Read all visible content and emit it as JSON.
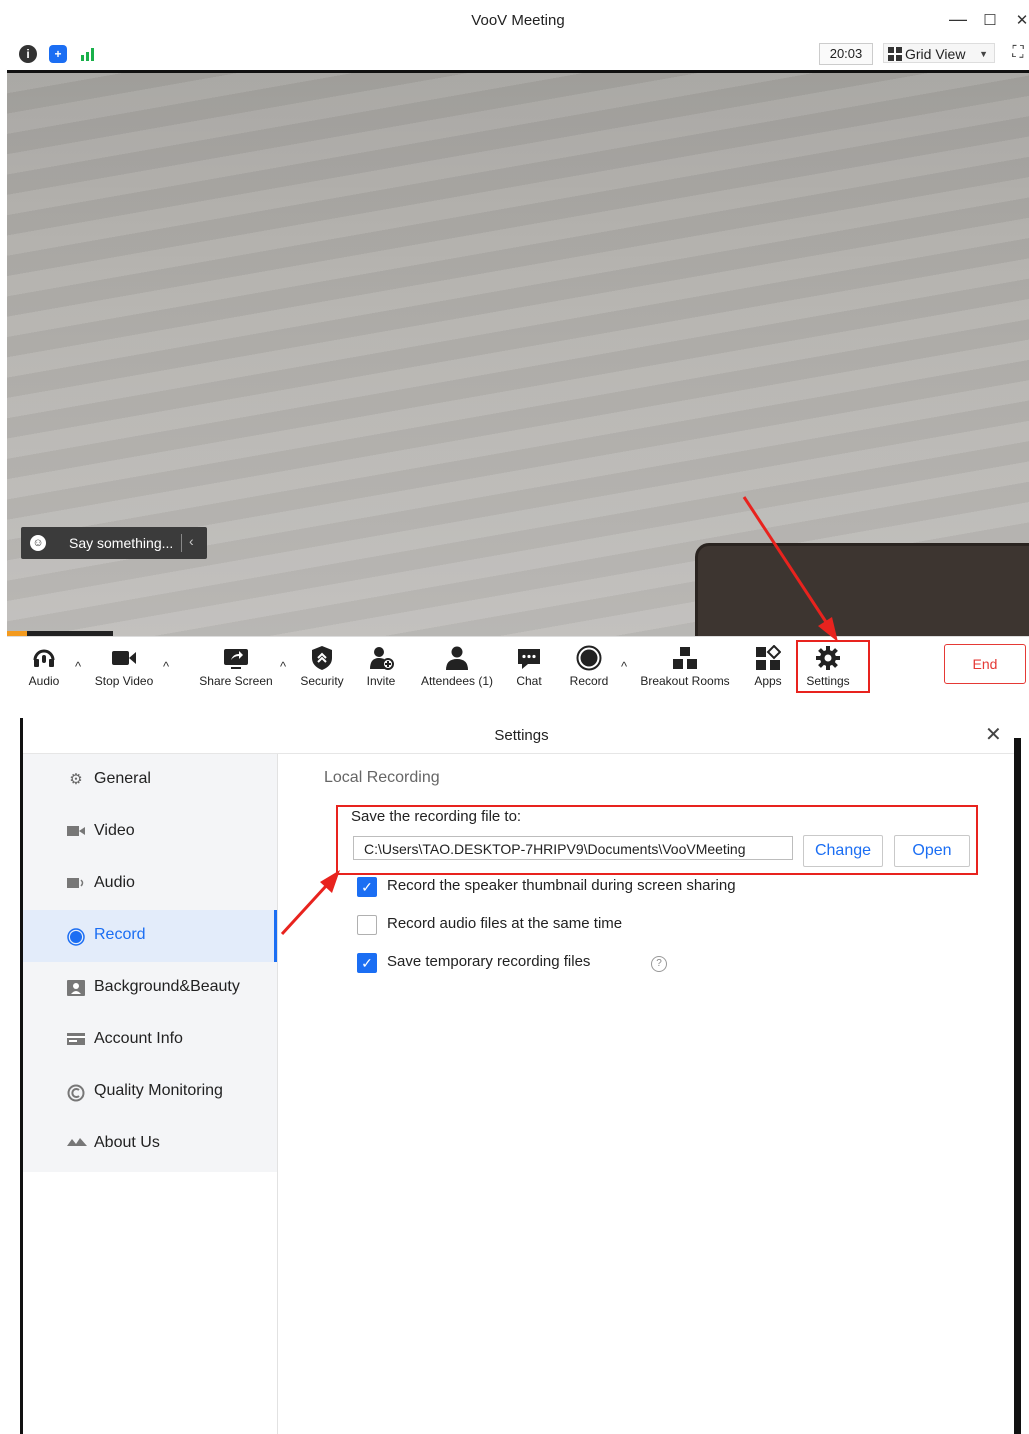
{
  "meeting": {
    "title": "VooV Meeting",
    "window_controls": {
      "minimize": "—",
      "maximize": "☐",
      "close": "✕",
      "fullscreen": "⛶"
    },
    "time": "20:03",
    "view_mode": "Grid View",
    "chat_input_placeholder": "Say something...",
    "toolbar": {
      "audio": "Audio",
      "stop_video": "Stop Video",
      "share_screen": "Share Screen",
      "security": "Security",
      "invite": "Invite",
      "attendees": "Attendees (1)",
      "chat": "Chat",
      "record": "Record",
      "breakout_rooms": "Breakout Rooms",
      "apps": "Apps",
      "settings": "Settings",
      "end": "End"
    }
  },
  "settings": {
    "title": "Settings",
    "close": "✕",
    "sidebar": {
      "items": [
        {
          "label": "General",
          "icon": "gear-icon",
          "active": false
        },
        {
          "label": "Video",
          "icon": "video-icon",
          "active": false
        },
        {
          "label": "Audio",
          "icon": "speaker-icon",
          "active": false
        },
        {
          "label": "Record",
          "icon": "record-icon",
          "active": true
        },
        {
          "label": "Background&Beauty",
          "icon": "background-icon",
          "active": false
        },
        {
          "label": "Account Info",
          "icon": "account-icon",
          "active": false
        },
        {
          "label": "Quality Monitoring",
          "icon": "quality-icon",
          "active": false
        },
        {
          "label": "About Us",
          "icon": "about-icon",
          "active": false
        }
      ]
    },
    "record": {
      "section_title": "Local Recording",
      "save_label": "Save the recording file to:",
      "path": "C:\\Users\\TAO.DESKTOP-7HRIPV9\\Documents\\VooVMeeting",
      "change_button": "Change",
      "open_button": "Open",
      "options": [
        {
          "label": "Record the speaker thumbnail during screen sharing",
          "checked": true
        },
        {
          "label": "Record audio files at the same time",
          "checked": false
        },
        {
          "label": "Save temporary recording files",
          "checked": true
        }
      ]
    }
  },
  "colors": {
    "accent": "#1b6ef3",
    "highlight": "#e8231e",
    "end": "#e53935"
  }
}
